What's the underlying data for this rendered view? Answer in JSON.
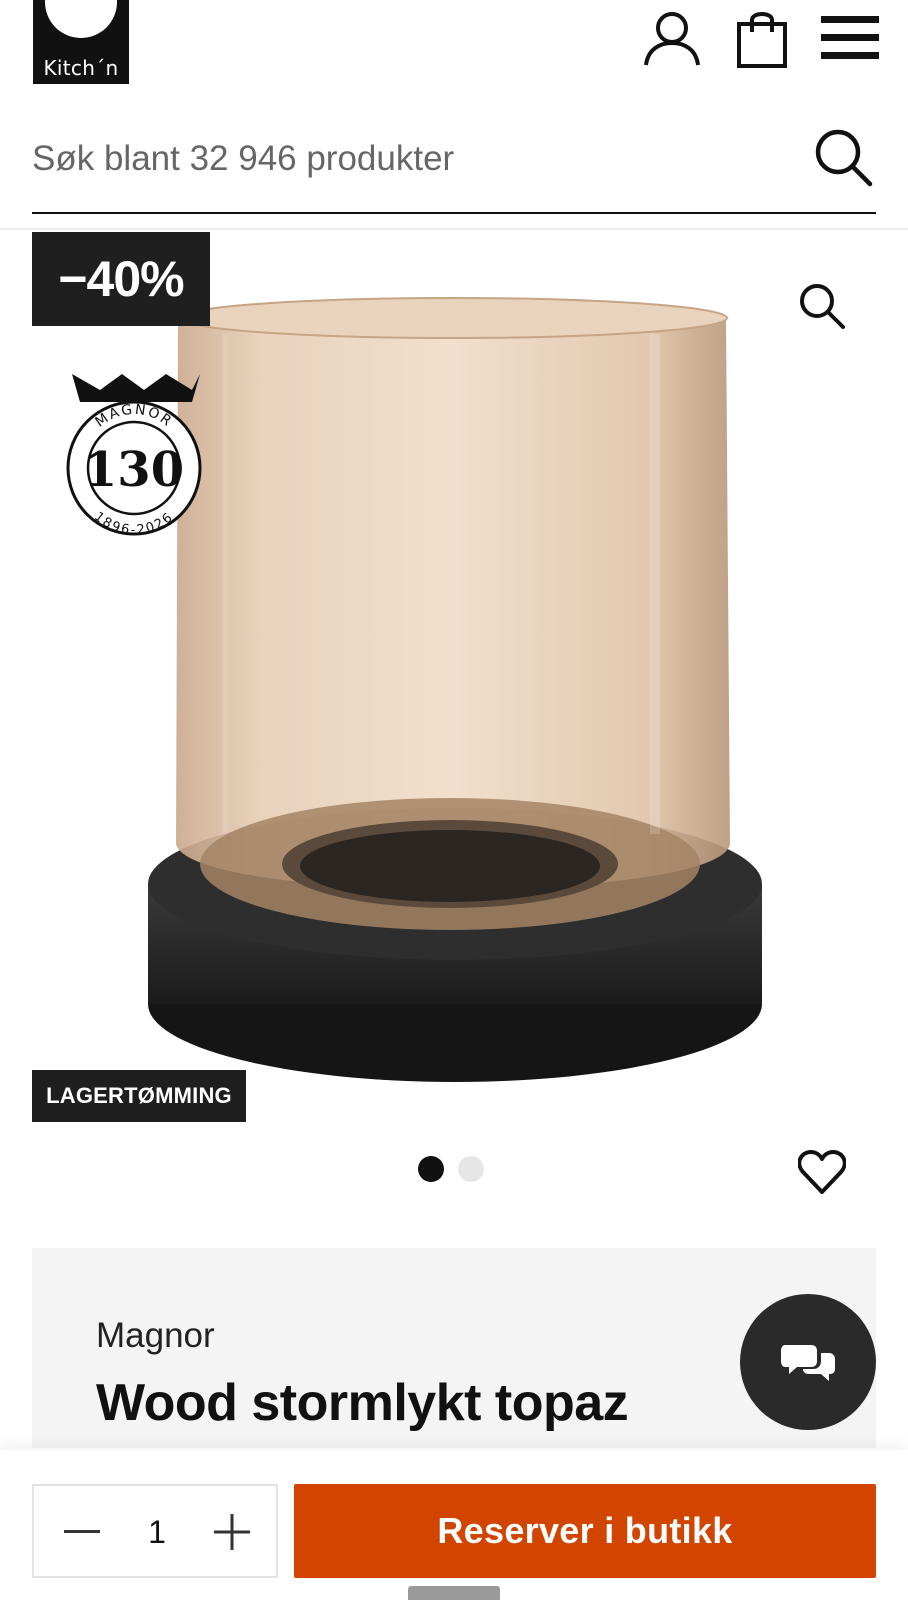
{
  "brand_logo": {
    "text": "Kitch´n"
  },
  "header": {
    "icons": [
      "user-icon",
      "shopping-bag-icon",
      "menu-icon"
    ]
  },
  "search": {
    "placeholder": "Søk blant 32 946 produkter",
    "icon": "search-icon"
  },
  "product": {
    "discount_label": "−40%",
    "anniversary_badge": {
      "brand": "MAGNOR",
      "number": "130",
      "years": "1896-2026"
    },
    "tag": "LAGERTØMMING",
    "gallery": {
      "image_count": 2,
      "active_index": 0
    },
    "brand": "Magnor",
    "title": "Wood stormlykt topaz"
  },
  "cart": {
    "quantity": "1",
    "reserve_label": "Reserver i butikk"
  },
  "colors": {
    "primary_button": "#d24500",
    "dark": "#1f1f1f",
    "panel_bg": "#f4f4f4"
  }
}
